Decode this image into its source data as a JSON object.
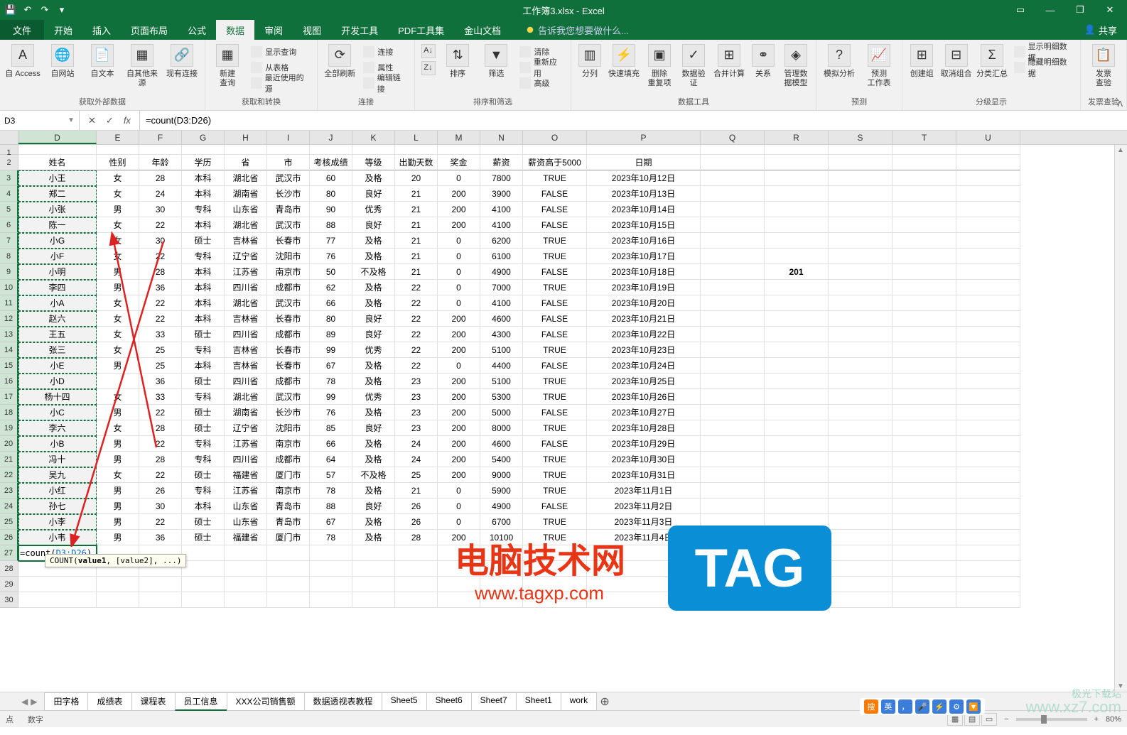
{
  "title": "工作簿3.xlsx - Excel",
  "qa": {
    "save": "💾",
    "undo": "↶",
    "redo": "↷"
  },
  "win": {
    "ribbon_opts": "▭",
    "min": "—",
    "max": "❐",
    "close": "✕"
  },
  "tabs": {
    "file": "文件",
    "items": [
      "开始",
      "插入",
      "页面布局",
      "公式",
      "数据",
      "审阅",
      "视图",
      "开发工具",
      "PDF工具集",
      "金山文档"
    ],
    "active_index": 4,
    "tell_me": "告诉我您想要做什么...",
    "share": "共享"
  },
  "ribbon": {
    "g1": {
      "label": "获取外部数据",
      "btns": [
        "自 Access",
        "自网站",
        "自文本",
        "自其他来源",
        "现有连接"
      ]
    },
    "g2": {
      "label": "获取和转换",
      "lg": "新建\n查询",
      "rows": [
        "显示查询",
        "从表格",
        "最近使用的源"
      ]
    },
    "g3": {
      "label": "连接",
      "lg": "全部刷新",
      "rows": [
        "连接",
        "属性",
        "编辑链接"
      ]
    },
    "g4": {
      "label": "排序和筛选",
      "btns": [
        "排序",
        "筛选"
      ],
      "rows": [
        "清除",
        "重新应用",
        "高级"
      ]
    },
    "g5": {
      "label": "数据工具",
      "btns": [
        "分列",
        "快速填充",
        "删除\n重复项",
        "数据验\n证",
        "合并计算",
        "关系",
        "管理数\n据模型"
      ]
    },
    "g6": {
      "label": "预测",
      "btns": [
        "模拟分析",
        "预测\n工作表"
      ]
    },
    "g7": {
      "label": "分级显示",
      "btns": [
        "创建组",
        "取消组合",
        "分类汇总"
      ],
      "rows": [
        "显示明细数据",
        "隐藏明细数据"
      ]
    },
    "g8": {
      "label": "发票查验",
      "btn": "发票\n查验"
    },
    "collapse": "ᐱ"
  },
  "name_box": "D3",
  "fx": {
    "cancel": "✕",
    "enter": "✓",
    "fx": "fx"
  },
  "formula": "=count(D3:D26)",
  "formula_display": "=count(D3:D26)",
  "tooltip": {
    "fn": "COUNT(",
    "arg1": "value1",
    "rest": ", [value2], ...)"
  },
  "columns": [
    "D",
    "E",
    "F",
    "G",
    "H",
    "I",
    "J",
    "K",
    "L",
    "M",
    "N",
    "O",
    "P",
    "Q",
    "R",
    "S",
    "T",
    "U"
  ],
  "headers": [
    "姓名",
    "性别",
    "年龄",
    "学历",
    "省",
    "市",
    "考核成绩",
    "等级",
    "出勤天数",
    "奖金",
    "薪资",
    "薪资高于5000",
    "日期"
  ],
  "r201": "201",
  "chart_data": {
    "type": "table",
    "columns": [
      "姓名",
      "性别",
      "年龄",
      "学历",
      "省",
      "市",
      "考核成绩",
      "等级",
      "出勤天数",
      "奖金",
      "薪资",
      "薪资高于5000",
      "日期"
    ],
    "rows": [
      [
        "小王",
        "女",
        "28",
        "本科",
        "湖北省",
        "武汉市",
        "60",
        "及格",
        "20",
        "0",
        "7800",
        "TRUE",
        "2023年10月12日"
      ],
      [
        "郑二",
        "女",
        "24",
        "本科",
        "湖南省",
        "长沙市",
        "80",
        "良好",
        "21",
        "200",
        "3900",
        "FALSE",
        "2023年10月13日"
      ],
      [
        "小张",
        "男",
        "30",
        "专科",
        "山东省",
        "青岛市",
        "90",
        "优秀",
        "21",
        "200",
        "4100",
        "FALSE",
        "2023年10月14日"
      ],
      [
        "陈一",
        "女",
        "22",
        "本科",
        "湖北省",
        "武汉市",
        "88",
        "良好",
        "21",
        "200",
        "4100",
        "FALSE",
        "2023年10月15日"
      ],
      [
        "小G",
        "女",
        "30",
        "硕士",
        "吉林省",
        "长春市",
        "77",
        "及格",
        "21",
        "0",
        "6200",
        "TRUE",
        "2023年10月16日"
      ],
      [
        "小F",
        "女",
        "22",
        "专科",
        "辽宁省",
        "沈阳市",
        "76",
        "及格",
        "21",
        "0",
        "6100",
        "TRUE",
        "2023年10月17日"
      ],
      [
        "小明",
        "男",
        "28",
        "本科",
        "江苏省",
        "南京市",
        "50",
        "不及格",
        "21",
        "0",
        "4900",
        "FALSE",
        "2023年10月18日"
      ],
      [
        "李四",
        "男",
        "36",
        "本科",
        "四川省",
        "成都市",
        "62",
        "及格",
        "22",
        "0",
        "7000",
        "TRUE",
        "2023年10月19日"
      ],
      [
        "小A",
        "女",
        "22",
        "本科",
        "湖北省",
        "武汉市",
        "66",
        "及格",
        "22",
        "0",
        "4100",
        "FALSE",
        "2023年10月20日"
      ],
      [
        "赵六",
        "女",
        "22",
        "本科",
        "吉林省",
        "长春市",
        "80",
        "良好",
        "22",
        "200",
        "4600",
        "FALSE",
        "2023年10月21日"
      ],
      [
        "王五",
        "女",
        "33",
        "硕士",
        "四川省",
        "成都市",
        "89",
        "良好",
        "22",
        "200",
        "4300",
        "FALSE",
        "2023年10月22日"
      ],
      [
        "张三",
        "女",
        "25",
        "专科",
        "吉林省",
        "长春市",
        "99",
        "优秀",
        "22",
        "200",
        "5100",
        "TRUE",
        "2023年10月23日"
      ],
      [
        "小E",
        "男",
        "25",
        "本科",
        "吉林省",
        "长春市",
        "67",
        "及格",
        "22",
        "0",
        "4400",
        "FALSE",
        "2023年10月24日"
      ],
      [
        "小D",
        "",
        "36",
        "硕士",
        "四川省",
        "成都市",
        "78",
        "及格",
        "23",
        "200",
        "5100",
        "TRUE",
        "2023年10月25日"
      ],
      [
        "杨十四",
        "女",
        "33",
        "专科",
        "湖北省",
        "武汉市",
        "99",
        "优秀",
        "23",
        "200",
        "5300",
        "TRUE",
        "2023年10月26日"
      ],
      [
        "小C",
        "男",
        "22",
        "硕士",
        "湖南省",
        "长沙市",
        "76",
        "及格",
        "23",
        "200",
        "5000",
        "FALSE",
        "2023年10月27日"
      ],
      [
        "李六",
        "女",
        "28",
        "硕士",
        "辽宁省",
        "沈阳市",
        "85",
        "良好",
        "23",
        "200",
        "8000",
        "TRUE",
        "2023年10月28日"
      ],
      [
        "小B",
        "男",
        "22",
        "专科",
        "江苏省",
        "南京市",
        "66",
        "及格",
        "24",
        "200",
        "4600",
        "FALSE",
        "2023年10月29日"
      ],
      [
        "冯十",
        "男",
        "28",
        "专科",
        "四川省",
        "成都市",
        "64",
        "及格",
        "24",
        "200",
        "5400",
        "TRUE",
        "2023年10月30日"
      ],
      [
        "吴九",
        "女",
        "22",
        "硕士",
        "福建省",
        "厦门市",
        "57",
        "不及格",
        "25",
        "200",
        "9000",
        "TRUE",
        "2023年10月31日"
      ],
      [
        "小红",
        "男",
        "26",
        "专科",
        "江苏省",
        "南京市",
        "78",
        "及格",
        "21",
        "0",
        "5900",
        "TRUE",
        "2023年11月1日"
      ],
      [
        "孙七",
        "男",
        "30",
        "本科",
        "山东省",
        "青岛市",
        "88",
        "良好",
        "26",
        "0",
        "4900",
        "FALSE",
        "2023年11月2日"
      ],
      [
        "小李",
        "男",
        "22",
        "硕士",
        "山东省",
        "青岛市",
        "67",
        "及格",
        "26",
        "0",
        "6700",
        "TRUE",
        "2023年11月3日"
      ],
      [
        "小韦",
        "男",
        "36",
        "硕士",
        "福建省",
        "厦门市",
        "78",
        "及格",
        "28",
        "200",
        "10100",
        "TRUE",
        "2023年11月4日"
      ]
    ]
  },
  "sheets": {
    "nav": [
      "◀",
      "▶"
    ],
    "tabs": [
      "田字格",
      "成绩表",
      "课程表",
      "员工信息",
      "XXX公司销售额",
      "数据透视表教程",
      "Sheet5",
      "Sheet6",
      "Sheet7",
      "Sheet1",
      "work"
    ],
    "active_index": 3,
    "add": "⊕"
  },
  "status": {
    "left1": "点",
    "left2": "数字",
    "zoom": "80%",
    "plus": "+",
    "minus": "−"
  },
  "watermark": {
    "cn": "电脑技术网",
    "url": "www.tagxp.com",
    "tag": "TAG",
    "xz_cn": "极光下载站",
    "xz_en": "www.xz7.com"
  },
  "ime": [
    "搜",
    "英",
    "，",
    "🎤",
    "⚡",
    "⚙",
    "🔽"
  ]
}
